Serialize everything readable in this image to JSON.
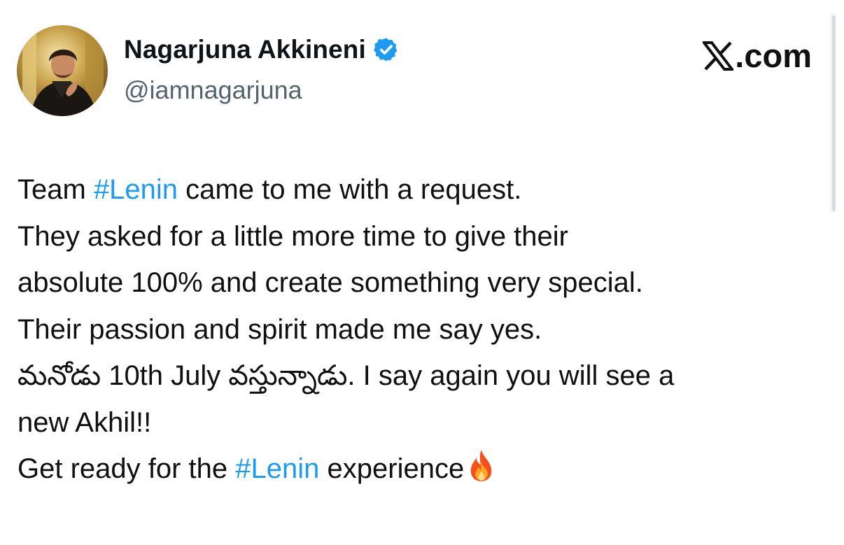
{
  "author": {
    "display_name": "Nagarjuna Akkineni",
    "handle": "@iamnagarjuna",
    "verified_icon": "verified-badge-icon",
    "avatar_icon": "profile-photo"
  },
  "brand": {
    "label": ".com",
    "icon": "x-logo-icon"
  },
  "tweet": {
    "lines": [
      {
        "before": "Team ",
        "hashtag": "#Lenin",
        "after": " came to me with a request."
      },
      {
        "text": "They asked for a little more time to give their"
      },
      {
        "text": "absolute 100% and create something very special."
      },
      {
        "text": "Their passion and spirit made me say yes."
      },
      {
        "text": "మనోడు 10th July వస్తున్నాడు. I say again you will see a"
      },
      {
        "text": "new Akhil!!"
      },
      {
        "before": "Get ready for the ",
        "hashtag": "#Lenin",
        "after": " experience",
        "emoji": "fire-icon"
      }
    ]
  },
  "colors": {
    "hashtag": "#1d9bf0",
    "verified": "#1d9bf0",
    "handle": "#536471"
  }
}
